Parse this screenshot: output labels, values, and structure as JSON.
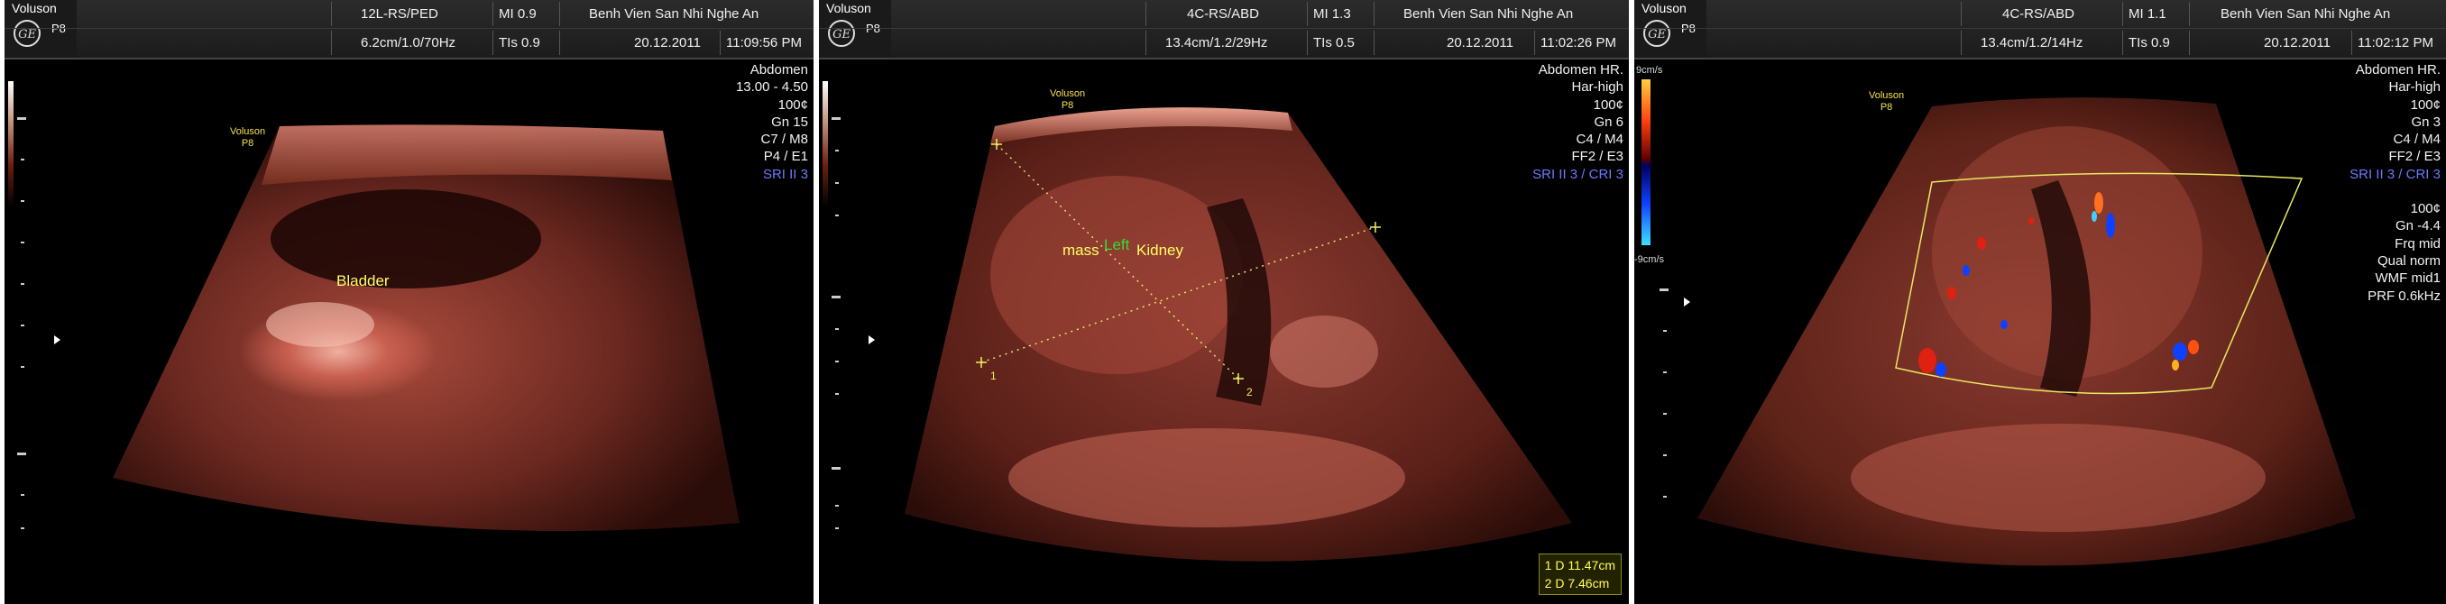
{
  "panels": [
    {
      "brand": "Voluson",
      "model": "P8",
      "logo_text": "GE",
      "probe": "12L-RS/PED",
      "depth_info": "6.2cm/1.0/70Hz",
      "mi": "MI  0.9",
      "tis": "TIs  0.9",
      "hospital": "Benh Vien San Nhi Nghe An",
      "date": "20.12.2011",
      "time": "11:09:56 PM",
      "params": [
        "Abdomen",
        "13.00 - 4.50",
        "100¢",
        "Gn  15",
        "C7 / M8",
        "P4 / E1"
      ],
      "sri": "SRI II 3",
      "annotations": [
        {
          "text": "Bladder"
        }
      ],
      "small_logo": [
        "Voluson",
        "P8"
      ]
    },
    {
      "brand": "Voluson",
      "model": "P8",
      "logo_text": "GE",
      "probe": "4C-RS/ABD",
      "depth_info": "13.4cm/1.2/29Hz",
      "mi": "MI  1.3",
      "tis": "TIs  0.5",
      "hospital": "Benh Vien San Nhi Nghe An",
      "date": "20.12.2011",
      "time": "11:02:26 PM",
      "params": [
        "Abdomen HR.",
        "Har-high",
        "100¢",
        "Gn  6",
        "C4 / M4",
        "FF2 / E3"
      ],
      "sri": "SRI II 3 / CRI 3",
      "annotations": [
        {
          "text": "mass"
        },
        {
          "text": "Left"
        },
        {
          "text": "Kidney"
        }
      ],
      "calipers": [
        "1",
        "2"
      ],
      "measurements": [
        "1   D  11.47cm",
        "2   D  7.46cm"
      ],
      "small_logo": [
        "Voluson",
        "P8"
      ]
    },
    {
      "brand": "Voluson",
      "model": "P8",
      "logo_text": "GE",
      "probe": "4C-RS/ABD",
      "depth_info": "13.4cm/1.2/14Hz",
      "mi": "MI  1.1",
      "tis": "TIs  0.9",
      "hospital": "Benh Vien San Nhi Nghe An",
      "date": "20.12.2011",
      "time": "11:02:12 PM",
      "params": [
        "Abdomen HR.",
        "Har-high",
        "100¢",
        "Gn  3",
        "C4 / M4",
        "FF2 / E3"
      ],
      "sri": "SRI II 3 / CRI 3",
      "doppler_params": [
        "100¢",
        "Gn -4.4",
        "Frq mid",
        "Qual norm",
        "WMF mid1",
        "PRF  0.6kHz"
      ],
      "color_bar": {
        "top": "9cm/s",
        "bottom": "-9cm/s"
      },
      "small_logo": [
        "Voluson",
        "P8"
      ]
    }
  ],
  "colors": {
    "tissue": "#c85a4a",
    "annotation_yellow": "#ffff66",
    "annotation_green": "#33dd33",
    "sri_blue": "#6f78ff",
    "background": "#000000"
  }
}
